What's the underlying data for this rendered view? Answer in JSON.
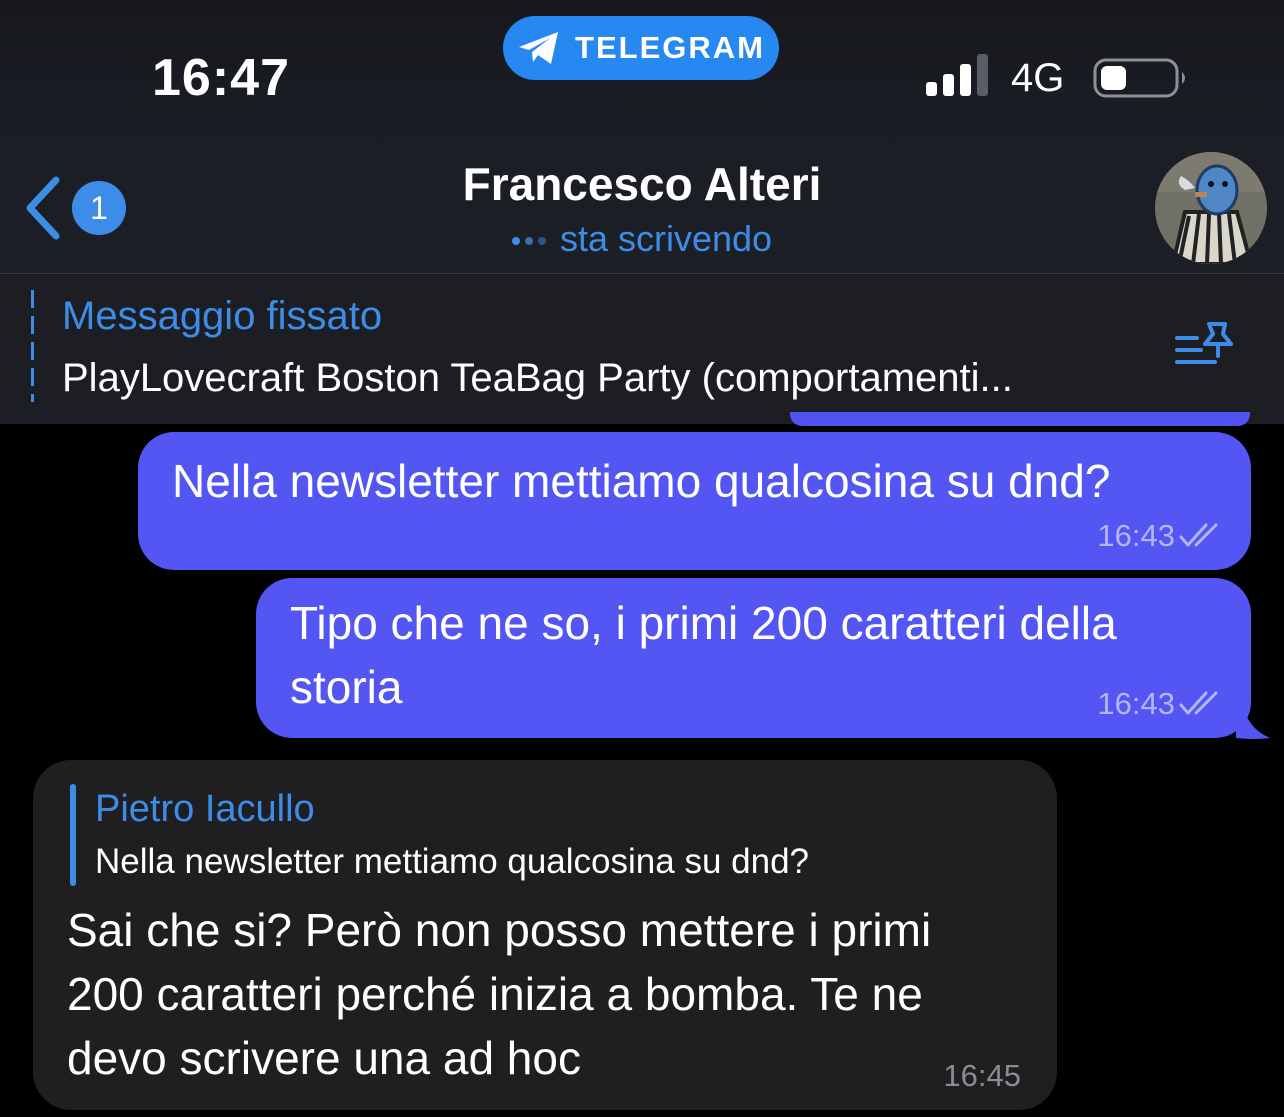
{
  "status_bar": {
    "time": "16:47",
    "app_indicator": "TELEGRAM",
    "network": "4G",
    "signal_icon": "signal-bars-icon",
    "battery_icon": "battery-icon",
    "battery_level": 0.35
  },
  "header": {
    "back_icon": "chevron-left-icon",
    "unread_count": "1",
    "contact_name": "Francesco Alteri",
    "typing_status": "sta scrivendo",
    "avatar_icon": "contact-avatar"
  },
  "pinned": {
    "title": "Messaggio fissato",
    "text": "PlayLovecraft Boston TeaBag Party (comportamenti...",
    "list_icon": "pinned-list-icon"
  },
  "messages": [
    {
      "direction": "outgoing",
      "text": "Nella newsletter mettiamo qualcosina su dnd?",
      "time": "16:43",
      "status": "read"
    },
    {
      "direction": "outgoing",
      "lines": [
        "Tipo che ne so, i primi 200 caratteri della",
        "storia"
      ],
      "time": "16:43",
      "status": "read"
    },
    {
      "direction": "incoming",
      "reply_to": {
        "author": "Pietro Iacullo",
        "text": "Nella newsletter mettiamo qualcosina su dnd?"
      },
      "lines": [
        "Sai che si? Però non posso mettere i primi",
        "200 caratteri perché inizia a bomba. Te ne",
        "devo scrivere una ad hoc"
      ],
      "time": "16:45"
    }
  ],
  "colors": {
    "accent": "#3d8de8",
    "outgoing_bubble": "#5456f4",
    "incoming_bubble": "#1f1f21",
    "header_bg": "#1c1f26",
    "chat_bg": "#000000"
  }
}
